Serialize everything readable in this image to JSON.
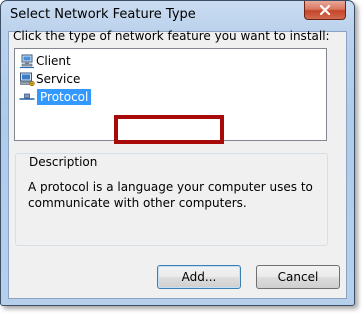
{
  "window": {
    "title": "Select Network Feature Type",
    "close_icon": "close-icon"
  },
  "instruction": "Click the type of network feature you want to install:",
  "features": [
    {
      "label": "Client",
      "icon": "client-icon",
      "selected": false
    },
    {
      "label": "Service",
      "icon": "service-icon",
      "selected": false
    },
    {
      "label": "Protocol",
      "icon": "protocol-icon",
      "selected": true
    }
  ],
  "description": {
    "legend": "Description",
    "text": "A protocol is a language your computer uses to communicate with other computers."
  },
  "buttons": {
    "add": "Add...",
    "cancel": "Cancel"
  },
  "colors": {
    "selection": "#3399ff",
    "highlight_box": "#a80a0a",
    "close_button": "#c4452a"
  }
}
